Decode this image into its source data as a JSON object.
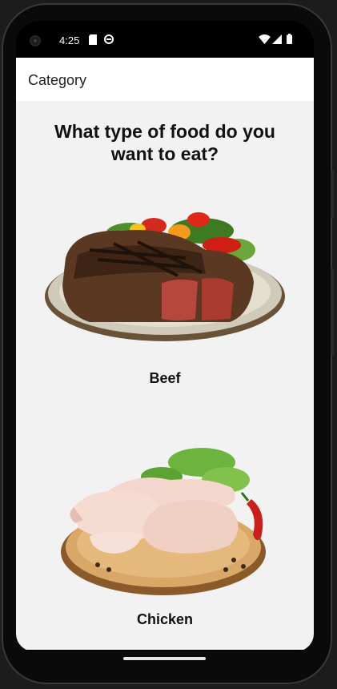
{
  "status_bar": {
    "time": "4:25",
    "left_icons": [
      "sd-card-icon",
      "sync-icon"
    ],
    "right_icons": [
      "wifi-icon",
      "signal-icon",
      "battery-icon"
    ]
  },
  "app_bar": {
    "title": "Category"
  },
  "main": {
    "question": "What type of food do you want to eat?",
    "categories": [
      {
        "label": "Beef",
        "image": "steak-plate-image"
      },
      {
        "label": "Chicken",
        "image": "chicken-board-image"
      }
    ]
  },
  "colors": {
    "app_bar_background": "#ffffff",
    "content_background": "#f2f2f2",
    "text": "#111111"
  }
}
